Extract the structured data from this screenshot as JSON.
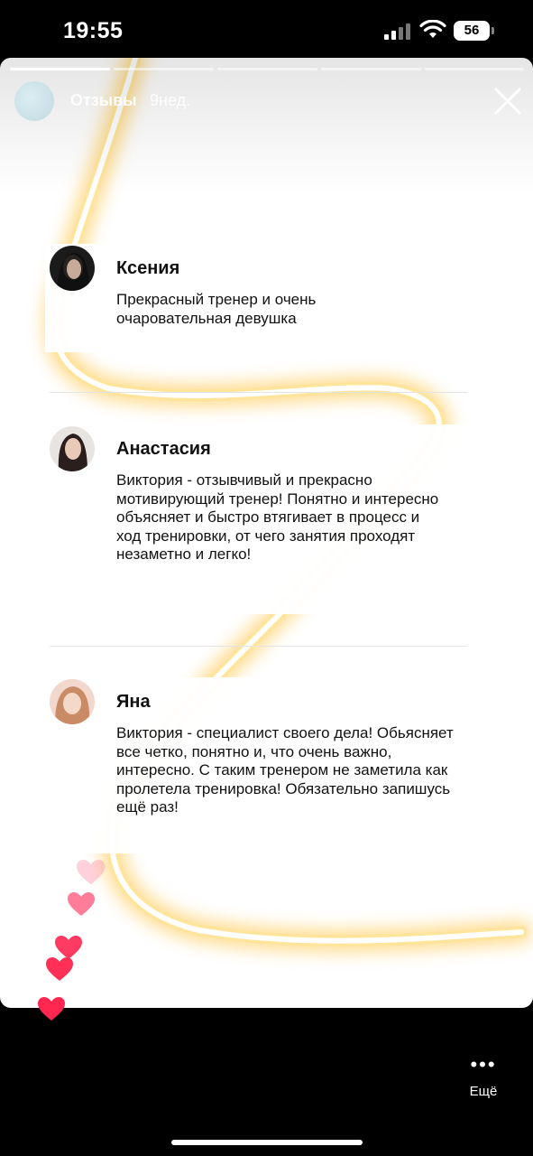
{
  "status": {
    "time": "19:55",
    "battery": "56"
  },
  "story": {
    "title": "Отзывы",
    "age": "9нед.",
    "progress_segments": 5,
    "current_segment": 1
  },
  "reviews": [
    {
      "name": "Ксения",
      "text": "Прекрасный тренер и очень очаровательная девушка"
    },
    {
      "name": "Анастасия",
      "text": "Виктория - отзывчивый и прекрасно мотивирующий тренер! Понятно и интересно объясняет и быстро втягивает в процесс и ход тренировки, от чего занятия проходят незаметно и легко!"
    },
    {
      "name": "Яна",
      "text": "Виктория - специалист своего дела! Обьясняет все четко, понятно и, что очень важно, интересно. С таким тренером не заметила как пролетела тренировка! Обязательно запишусь ещё раз!"
    }
  ],
  "actions": {
    "more_label": "Ещё"
  }
}
